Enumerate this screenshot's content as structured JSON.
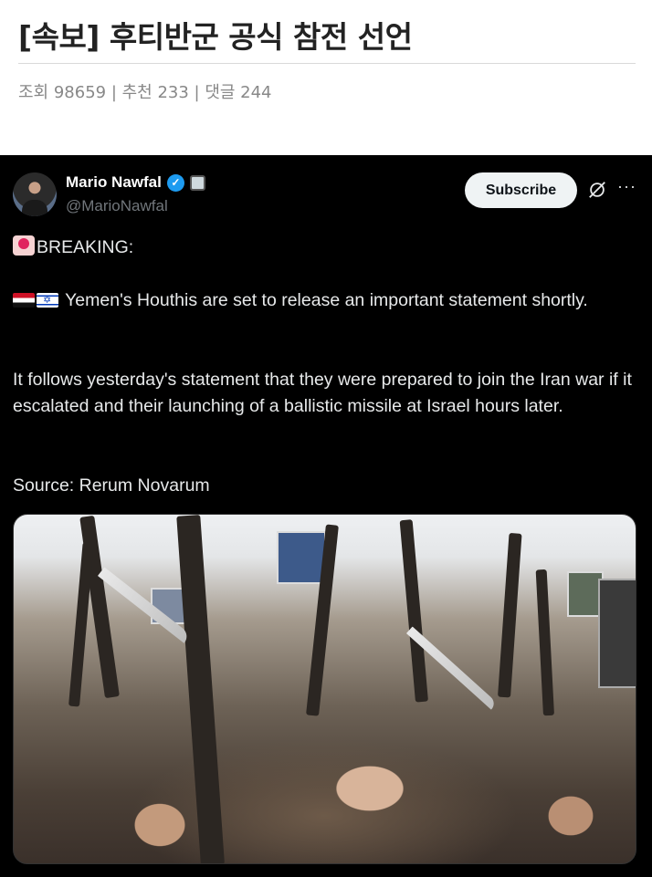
{
  "post": {
    "title": "[속보] 후티반군 공식 참전 선언",
    "stats": "조회 98659 | 추천 233 | 댓글 244"
  },
  "tweet": {
    "display_name": "Mario Nawfal",
    "handle": "@MarioNawfal",
    "subscribe_label": "Subscribe",
    "more_label": "···",
    "breaking": "BREAKING:",
    "line1": "Yemen's Houthis are set to release an important statement shortly.",
    "line2": "It follows yesterday's statement that they were prepared to join the Iran war if it escalated and their launching of a ballistic missile at Israel hours later.",
    "source": "Source: Rerum Novarum"
  },
  "icons": {
    "verified": "verified-check-icon",
    "affiliate": "affiliate-badge-icon",
    "grok": "grok-icon",
    "more": "more-horizontal-icon",
    "siren": "siren-emoji-icon",
    "flags": [
      "yemen-flag-icon",
      "israel-flag-icon"
    ]
  },
  "colors": {
    "tweet_background": "#000000",
    "verified_blue": "#1d9bf0",
    "handle_grey": "#71767b",
    "subscribe_bg": "#eff3f4"
  }
}
